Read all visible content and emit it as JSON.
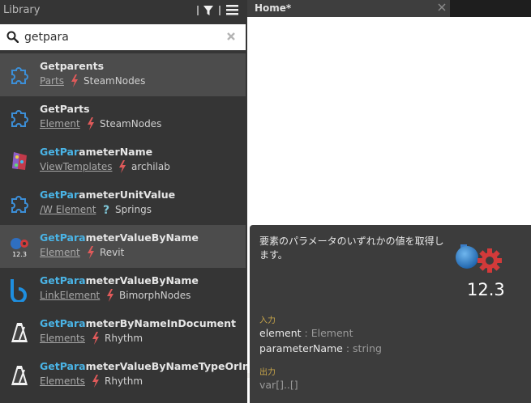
{
  "library": {
    "title": "Library",
    "search": {
      "value": "getpara",
      "placeholder": ""
    },
    "items": [
      {
        "name_match": "",
        "name_rest": "Getparents",
        "category": "Parts",
        "meta": "lightning",
        "package": "SteamNodes",
        "icon": "puzzle-icon",
        "highlighted": true
      },
      {
        "name_match": "",
        "name_rest": "GetParts",
        "category": "Element",
        "meta": "lightning",
        "package": "SteamNodes",
        "icon": "puzzle-icon",
        "highlighted": false
      },
      {
        "name_match": "GetPar",
        "name_rest": "ameterName",
        "category": "ViewTemplates",
        "meta": "lightning",
        "package": "archilab",
        "icon": "archilab-icon",
        "highlighted": false
      },
      {
        "name_match": "GetPar",
        "name_rest": "ameterUnitValue",
        "category": "/W Element",
        "meta": "question",
        "package": "Springs",
        "icon": "puzzle-icon",
        "highlighted": false
      },
      {
        "name_match": "GetPara",
        "name_rest": "meterValueByName",
        "category": "Element",
        "meta": "lightning",
        "package": "Revit",
        "icon": "dynamo-icon",
        "highlighted": true
      },
      {
        "name_match": "GetPara",
        "name_rest": "meterValueByName",
        "category": "LinkElement",
        "meta": "lightning",
        "package": "BimorphNodes",
        "icon": "bimorph-icon",
        "highlighted": false
      },
      {
        "name_match": "GetPara",
        "name_rest": "meterByNameInDocument",
        "category": "Elements",
        "meta": "lightning",
        "package": "Rhythm",
        "icon": "metronome-icon",
        "highlighted": false
      },
      {
        "name_match": "GetPara",
        "name_rest": "meterValueByNameTypeOrInstan",
        "category": "Elements",
        "meta": "lightning",
        "package": "Rhythm",
        "icon": "metronome-icon",
        "highlighted": false
      }
    ]
  },
  "workspace": {
    "tab_label": "Home*"
  },
  "tooltip": {
    "description": "要素のパラメータのいずれかの値を取得します。",
    "icon_caption": "12.3",
    "inputs_label": "入力",
    "inputs": [
      {
        "name": "element",
        "sep": " : ",
        "type": "Element"
      },
      {
        "name": "parameterName",
        "sep": " : ",
        "type": "string"
      }
    ],
    "outputs_label": "出力",
    "output": "var[]..[]"
  },
  "colors": {
    "match_highlight": "#4ab4e6",
    "lightning": "#e05a5a",
    "question": "#7fc7d9",
    "panel_bg": "#353535",
    "tooltip_bg": "#3c3c3c"
  }
}
